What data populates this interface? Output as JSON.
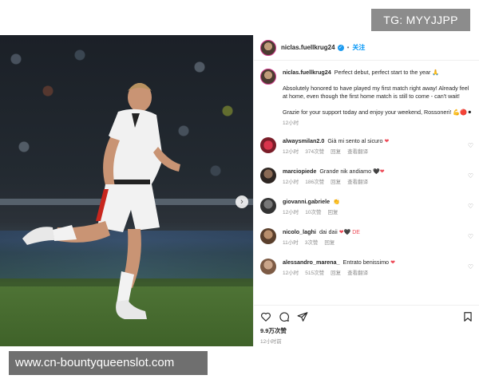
{
  "watermarks": {
    "top": "TG: MYYJJPP",
    "bottom": "www.cn-bountyqueenslot.com"
  },
  "post": {
    "author": "niclas.fuellkrug24",
    "follow_label": "关注",
    "caption": {
      "line1": "Perfect debut, perfect start to the year 🙏",
      "line2": "Absolutely honored to have played my first match right away! Already feel at home, even though the first home match is still to come - can't wait!",
      "line3": "Grazie for your support today and enjoy your weekend, Rossoneri! 💪🔴⚫",
      "time": "12小时"
    },
    "comments": [
      {
        "user": "alwaysmilan2.0",
        "text": "Già mi sento al sicuro",
        "emoji": "❤",
        "time": "12小时",
        "likes": "374次赞",
        "reply": "回复",
        "translate": "查看翻译"
      },
      {
        "user": "marciopiede",
        "text": "Grande nik andiamo",
        "emoji": "🖤❤",
        "time": "12小时",
        "likes": "186次赞",
        "reply": "回复",
        "translate": "查看翻译"
      },
      {
        "user": "giovanni.gabriele",
        "text": "",
        "emoji": "👏",
        "time": "12小时",
        "likes": "10次赞",
        "reply": "回复",
        "translate": ""
      },
      {
        "user": "nicolo_laghi",
        "text": "dai daii",
        "emoji": "❤🖤 DE",
        "time": "11小时",
        "likes": "3次赞",
        "reply": "回复",
        "translate": ""
      },
      {
        "user": "alessandro_marena_",
        "text": "Entrato benissimo",
        "emoji": "❤",
        "time": "12小时",
        "likes": "515次赞",
        "reply": "回复",
        "translate": "查看翻译"
      }
    ],
    "likes_count": "9.9万次赞",
    "post_time": "12小时前"
  },
  "colors": {
    "accent": "#0095f6",
    "heart": "#ed4956",
    "verified": "#1d9bf0"
  },
  "icons": [
    "heart-icon",
    "comment-icon",
    "share-icon",
    "bookmark-icon",
    "chevron-right-icon",
    "verified-icon"
  ]
}
